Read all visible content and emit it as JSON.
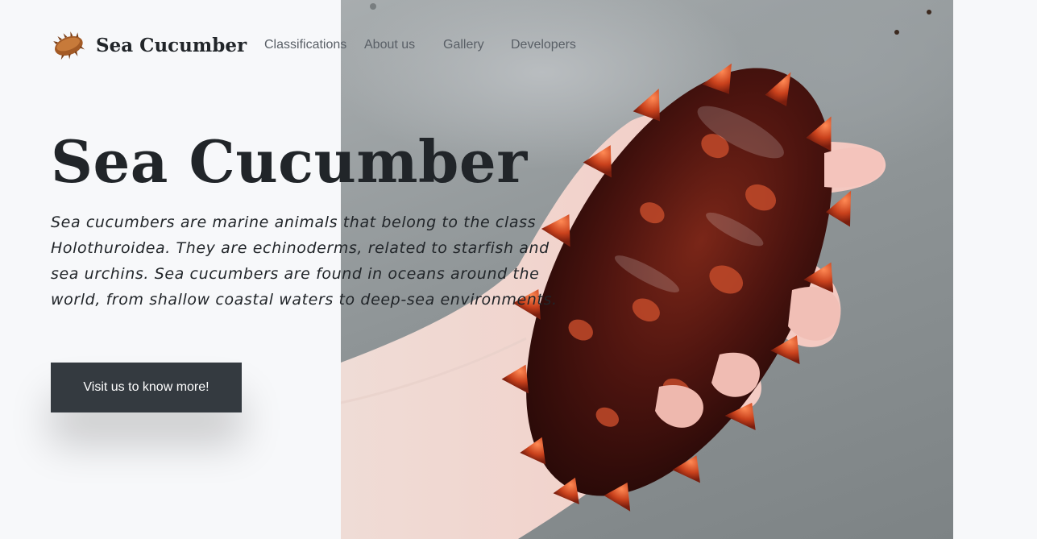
{
  "brand": {
    "name": "Sea Cucumber",
    "logo_icon": "sea-cucumber-logo-icon"
  },
  "nav": {
    "items": [
      {
        "label": "Classifications"
      },
      {
        "label": "About us"
      },
      {
        "label": "Gallery"
      },
      {
        "label": "Developers"
      }
    ]
  },
  "hero": {
    "title": "Sea Cucumber",
    "description": "Sea cucumbers are marine animals that belong to the class Holothuroidea. They are echinoderms, related to starfish and sea urchins. Sea cucumbers are found in oceans around the world, from shallow coastal waters to deep-sea environments.",
    "cta_label": "Visit us to know more!",
    "image_subject": "hand-holding-sea-cucumber-photo"
  },
  "colors": {
    "background": "#f7f8fa",
    "text": "#212529",
    "nav_text": "#595f66",
    "button_bg": "#343a40",
    "button_text": "#ffffff",
    "sea_cucumber_body": "#5a1a14",
    "sea_cucumber_spikes": "#c9411c"
  }
}
